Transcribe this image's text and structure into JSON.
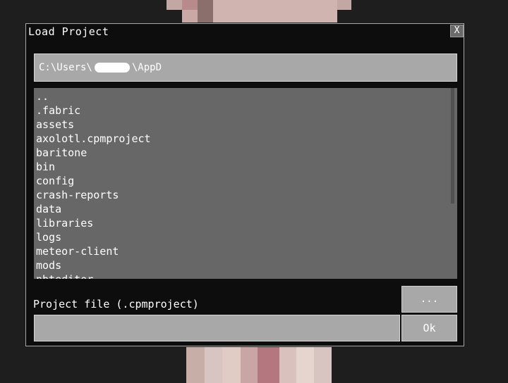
{
  "dialog": {
    "title": "Load Project",
    "close_label": "X",
    "path_prefix": "C:\\Users\\",
    "path_suffix": "\\AppD",
    "files": [
      "..",
      ".fabric",
      "assets",
      "axolotl.cpmproject",
      "baritone",
      "bin",
      "config",
      "crash-reports",
      "data",
      "libraries",
      "logs",
      "meteor-client",
      "mods",
      "nbteditor"
    ],
    "file_label": "Project file (.cpmproject)",
    "file_value": "",
    "browse_label": "...",
    "ok_label": "Ok"
  },
  "colors": {
    "dialog_bg": "#0d0d0d",
    "field_bg": "#a8a8a8",
    "list_bg": "#676767",
    "text": "#ffffff"
  }
}
